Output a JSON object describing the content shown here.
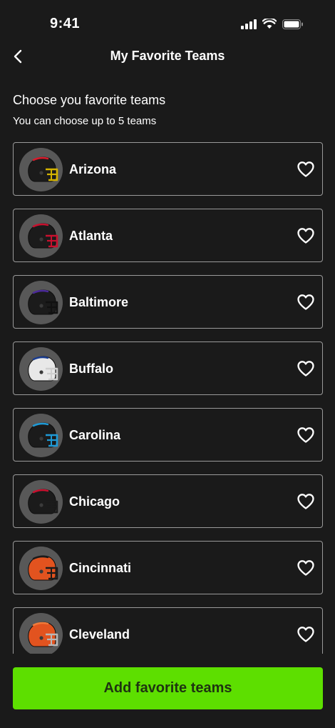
{
  "status": {
    "time": "9:41"
  },
  "header": {
    "title": "My Favorite Teams",
    "back_icon": "chevron-left-icon"
  },
  "intro": {
    "heading": "Choose you favorite teams",
    "subheading": "You can choose up to 5 teams"
  },
  "teams": [
    {
      "name": "Arizona",
      "shell": "#1b1b1b",
      "accent": "#d81b2b",
      "mask": "#d4b300",
      "favorite": false
    },
    {
      "name": "Atlanta",
      "shell": "#1b1b1b",
      "accent": "#c8102e",
      "mask": "#c8102e",
      "favorite": false
    },
    {
      "name": "Baltimore",
      "shell": "#1b1b1b",
      "accent": "#4b2a9a",
      "mask": "#111111",
      "favorite": false
    },
    {
      "name": "Buffalo",
      "shell": "#e8e8e8",
      "accent": "#1a3c8f",
      "mask": "#cfcfcf",
      "favorite": false
    },
    {
      "name": "Carolina",
      "shell": "#1b1b1b",
      "accent": "#1e9ad6",
      "mask": "#1e9ad6",
      "favorite": false
    },
    {
      "name": "Chicago",
      "shell": "#1b1b1b",
      "accent": "#c8102e",
      "mask": "#1b1b1b",
      "favorite": false
    },
    {
      "name": "Cincinnati",
      "shell": "#e2531f",
      "accent": "#1b1b1b",
      "mask": "#1b1b1b",
      "favorite": false
    },
    {
      "name": "Cleveland",
      "shell": "#e2531f",
      "accent": "#f07a3a",
      "mask": "#b8b8b8",
      "favorite": false
    }
  ],
  "cta": {
    "label": "Add favorite teams",
    "color": "#5ddf00"
  },
  "icons": {
    "favorite": "heart-outline-icon",
    "helmet": "helmet-icon"
  }
}
